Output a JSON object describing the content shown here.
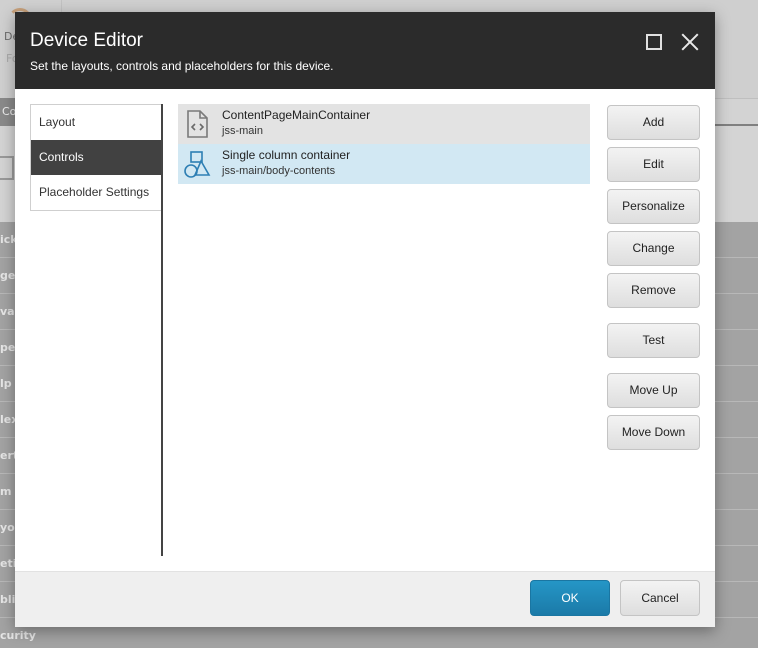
{
  "background": {
    "tile_text_1": "De",
    "tile_text_2": "Fo",
    "tab_label": "Co",
    "list_rows": [
      "ick",
      "ge",
      "var",
      "pe",
      "lp",
      "lex",
      "ert",
      "m I",
      "you",
      "etin",
      "blis",
      "curity"
    ]
  },
  "dialog": {
    "title": "Device Editor",
    "subtitle": "Set the layouts, controls and placeholders for this device.",
    "maximize_icon": "maximize-icon",
    "close_icon": "close-icon"
  },
  "nav": {
    "items": [
      {
        "label": "Layout",
        "active": false
      },
      {
        "label": "Controls",
        "active": true
      },
      {
        "label": "Placeholder Settings",
        "active": false
      }
    ]
  },
  "controls": [
    {
      "name": "ContentPageMainContainer",
      "placeholder": "jss-main",
      "icon": "code-file-icon",
      "selected": false
    },
    {
      "name": "Single column container",
      "placeholder": "jss-main/body-contents",
      "icon": "shapes-icon",
      "selected": true
    }
  ],
  "actions": {
    "add": "Add",
    "edit": "Edit",
    "personalize": "Personalize",
    "change": "Change",
    "remove": "Remove",
    "test": "Test",
    "move_up": "Move Up",
    "move_down": "Move Down"
  },
  "footer": {
    "ok": "OK",
    "cancel": "Cancel"
  },
  "colors": {
    "header_bg": "#2b2b2b",
    "nav_active_bg": "#414141",
    "selected_row_bg": "#d2e8f3",
    "primary_button": "#2596c6"
  }
}
